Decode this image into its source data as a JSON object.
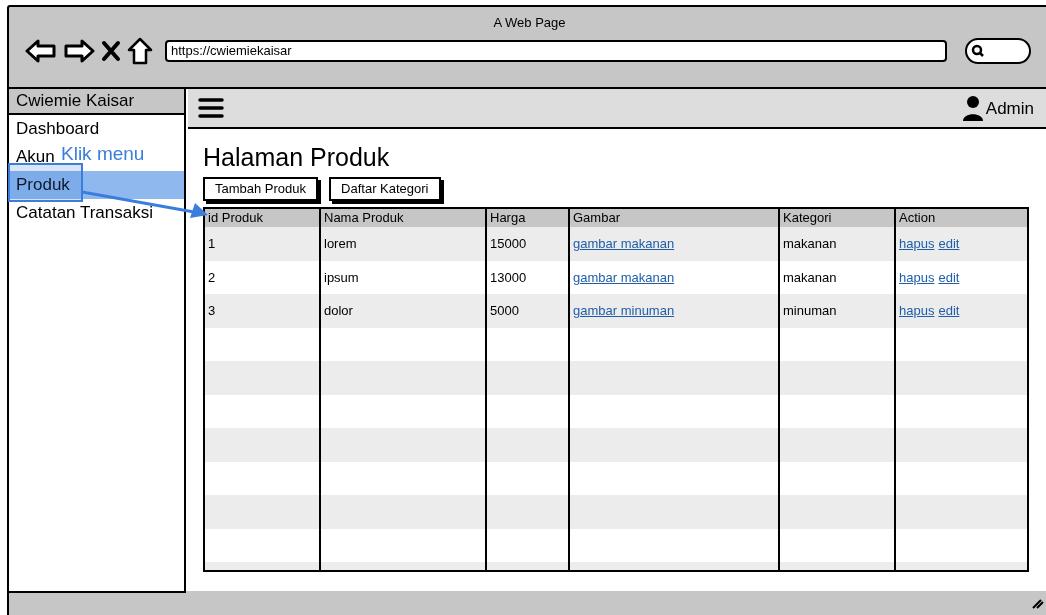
{
  "window": {
    "title": "A Web Page",
    "url": "https://cwiemiekaisar"
  },
  "sidebar": {
    "title": "Cwiemie Kaisar",
    "items": [
      {
        "label": "Dashboard",
        "selected": false
      },
      {
        "label": "Akun",
        "selected": false
      },
      {
        "label": "Produk",
        "selected": true
      },
      {
        "label": "Catatan Transaksi",
        "selected": false
      }
    ]
  },
  "annotation": {
    "text": "Klik menu"
  },
  "navbar": {
    "user": "Admin"
  },
  "page": {
    "heading": "Halaman Produk",
    "buttons": [
      "Tambah Produk",
      "Daftar Kategori"
    ]
  },
  "table": {
    "columns": [
      "id Produk",
      "Nama Produk",
      "Harga",
      "Gambar",
      "Kategori",
      "Action"
    ],
    "rows": [
      {
        "id": "1",
        "nama": "lorem",
        "harga": "15000",
        "gambar": "gambar makanan",
        "kategori": "makanan",
        "actions": [
          "hapus",
          "edit"
        ]
      },
      {
        "id": "2",
        "nama": "ipsum",
        "harga": "13000",
        "gambar": "gambar makanan",
        "kategori": "makanan",
        "actions": [
          "hapus",
          "edit"
        ]
      },
      {
        "id": "3",
        "nama": "dolor",
        "harga": "5000",
        "gambar": "gambar minuman",
        "kategori": "minuman",
        "actions": [
          "hapus",
          "edit"
        ]
      }
    ]
  }
}
